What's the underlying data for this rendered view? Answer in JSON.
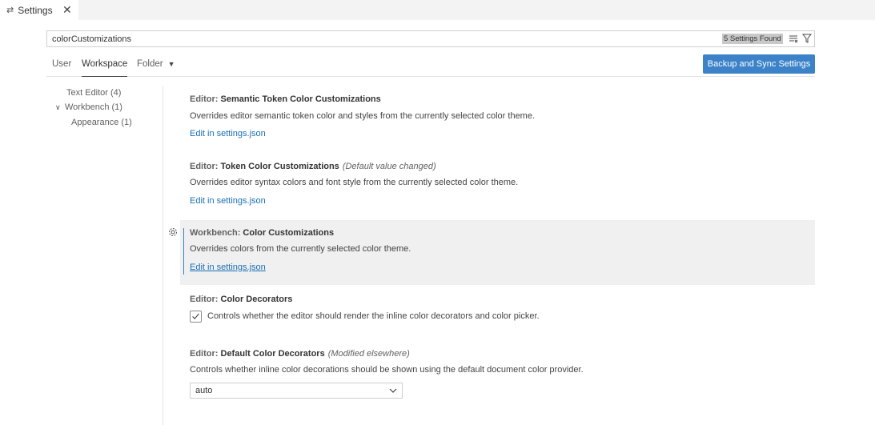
{
  "tab": {
    "icon": "settings-icon",
    "label": "Settings",
    "close": "✕"
  },
  "search": {
    "value": "colorCustomizations",
    "found": "5 Settings Found"
  },
  "scopes": {
    "user": "User",
    "workspace": "Workspace",
    "folder": "Folder"
  },
  "sync_button": "Backup and Sync Settings",
  "toc": {
    "text_editor": "Text Editor (4)",
    "workbench": "Workbench (1)",
    "appearance": "Appearance (1)"
  },
  "settings": [
    {
      "category": "Editor: ",
      "key": "Semantic Token Color Customizations",
      "note": "",
      "description": "Overrides editor semantic token color and styles from the currently selected color theme.",
      "link": "Edit in settings.json"
    },
    {
      "category": "Editor: ",
      "key": "Token Color Customizations",
      "note": "(Default value changed)",
      "description": "Overrides editor syntax colors and font style from the currently selected color theme.",
      "link": "Edit in settings.json"
    },
    {
      "category": "Workbench: ",
      "key": "Color Customizations",
      "note": "",
      "description": "Overrides colors from the currently selected color theme.",
      "link": "Edit in settings.json"
    },
    {
      "category": "Editor: ",
      "key": "Color Decorators",
      "note": "",
      "checkbox_label": "Controls whether the editor should render the inline color decorators and color picker.",
      "checked": true
    },
    {
      "category": "Editor: ",
      "key": "Default Color Decorators",
      "note": "(Modified elsewhere)",
      "description": "Controls whether inline color decorations should be shown using the default document color provider.",
      "select_value": "auto"
    }
  ],
  "colors": {
    "accent": "#3b82c8",
    "link": "#1a6fb5",
    "focused_bg": "#f0f0f0"
  }
}
